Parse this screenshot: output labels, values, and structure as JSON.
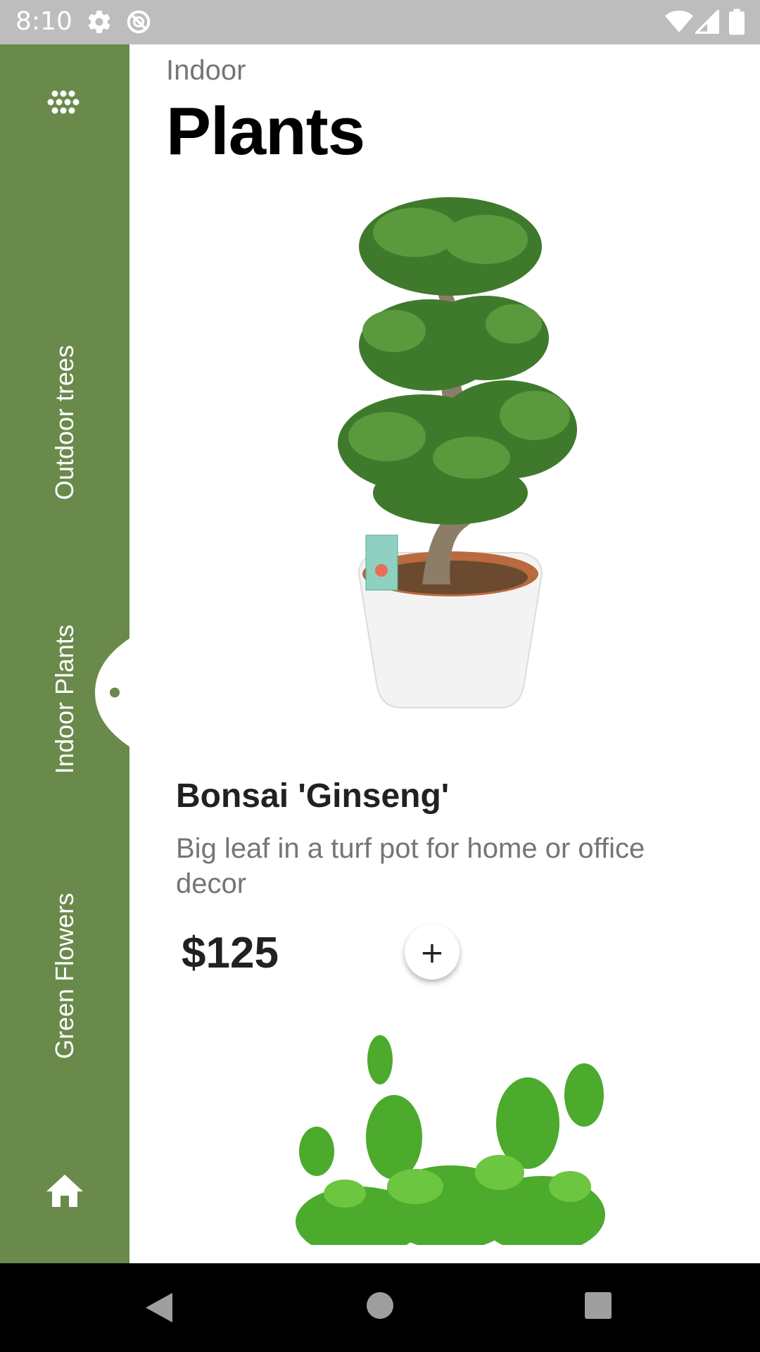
{
  "status_bar": {
    "time": "8:10",
    "icons": [
      "settings-icon",
      "no-disturb-icon",
      "wifi-icon",
      "signal-icon",
      "battery-icon"
    ]
  },
  "sidebar": {
    "color": "#698a4b",
    "menu_icon": "dots-grid-icon",
    "tabs": [
      {
        "label": "Outdoor trees",
        "active": false
      },
      {
        "label": "Indoor Plants",
        "active": true
      },
      {
        "label": "Green Flowers",
        "active": false
      }
    ],
    "home_icon": "home-icon"
  },
  "header": {
    "subtitle": "Indoor",
    "title": "Plants"
  },
  "product": {
    "name": "Bonsai 'Ginseng'",
    "description": "Big leaf in a turf pot for home or office decor",
    "price": "$125",
    "add_label": "+"
  },
  "navigation": {
    "buttons": [
      "back-icon",
      "home-circle-icon",
      "recents-icon"
    ]
  }
}
